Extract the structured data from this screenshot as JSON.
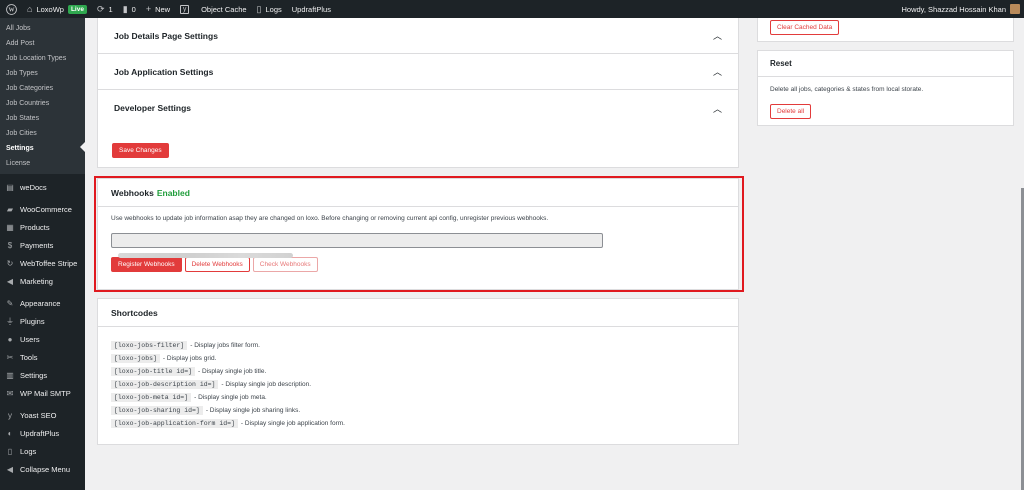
{
  "admin_bar": {
    "wp_logo": "wordpress-icon",
    "site_name": "LoxoWp",
    "live_badge": "Live",
    "updates_count": "1",
    "comments_count": "0",
    "new_label": "New",
    "object_cache": "Object Cache",
    "logs": "Logs",
    "updraftplus": "UpdraftPlus",
    "howdy": "Howdy, Shazzad Hossain Khan"
  },
  "sidebar": {
    "submenu": [
      {
        "label": "All Jobs"
      },
      {
        "label": "Add Post"
      },
      {
        "label": "Job Location Types"
      },
      {
        "label": "Job Types"
      },
      {
        "label": "Job Categories"
      },
      {
        "label": "Job Countries"
      },
      {
        "label": "Job States"
      },
      {
        "label": "Job Cities"
      },
      {
        "label": "Settings",
        "current": true
      },
      {
        "label": "License"
      }
    ],
    "menu": [
      {
        "label": "weDocs",
        "icon": "docs-icon"
      },
      {
        "label": "WooCommerce",
        "icon": "woocommerce-icon"
      },
      {
        "label": "Products",
        "icon": "products-icon"
      },
      {
        "label": "Payments",
        "icon": "payments-icon"
      },
      {
        "label": "WebToffee Stripe",
        "icon": "stripe-icon"
      },
      {
        "label": "Marketing",
        "icon": "megaphone-icon"
      },
      {
        "label": "Appearance",
        "icon": "brush-icon"
      },
      {
        "label": "Plugins",
        "icon": "plugin-icon"
      },
      {
        "label": "Users",
        "icon": "users-icon"
      },
      {
        "label": "Tools",
        "icon": "wrench-icon"
      },
      {
        "label": "Settings",
        "icon": "settings-icon"
      },
      {
        "label": "WP Mail SMTP",
        "icon": "mail-icon"
      },
      {
        "label": "Yoast SEO",
        "icon": "yoast-icon"
      },
      {
        "label": "UpdraftPlus",
        "icon": "updraft-icon"
      },
      {
        "label": "Logs",
        "icon": "logs-icon"
      },
      {
        "label": "Collapse Menu",
        "icon": "collapse-icon"
      }
    ]
  },
  "settings": {
    "sections": [
      {
        "title": "Job Details Page Settings"
      },
      {
        "title": "Job Application Settings"
      },
      {
        "title": "Developer Settings"
      }
    ],
    "save_label": "Save Changes"
  },
  "webhooks": {
    "title": "Webhooks",
    "status": "Enabled",
    "description": "Use webhooks to update job information asap they are changed on loxo. Before changing or removing current api config, unregister previous webhooks.",
    "register_label": "Register Webhooks",
    "delete_label": "Delete Webhooks",
    "check_label": "Check Webhooks"
  },
  "shortcodes": {
    "title": "Shortcodes",
    "items": [
      {
        "code": "[loxo-jobs-filter]",
        "desc": "- Display jobs filter form."
      },
      {
        "code": "[loxo-jobs]",
        "desc": "- Display jobs grid."
      },
      {
        "code": "[loxo-job-title id=]",
        "desc": "- Display single job title."
      },
      {
        "code": "[loxo-job-description id=]",
        "desc": "- Display single job description."
      },
      {
        "code": "[loxo-job-meta id=]",
        "desc": "- Display single job meta."
      },
      {
        "code": "[loxo-job-sharing id=]",
        "desc": "- Display single job sharing links."
      },
      {
        "code": "[loxo-job-application-form id=]",
        "desc": "- Display single job application form."
      }
    ]
  },
  "cache": {
    "clear_label": "Clear Cached Data"
  },
  "reset": {
    "title": "Reset",
    "description": "Delete all jobs, categories & states from local storate.",
    "delete_all_label": "Delete all"
  },
  "colors": {
    "accent": "#e23b3b",
    "enabled": "#1f9d3a",
    "highlight_border": "#e0191f",
    "sidebar_bg": "#1d2327"
  }
}
